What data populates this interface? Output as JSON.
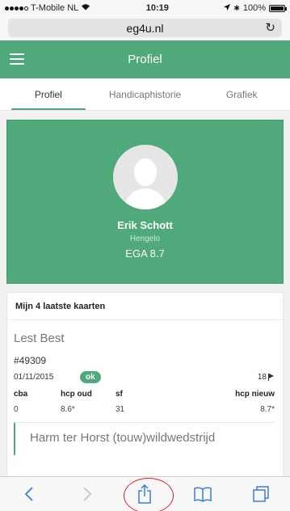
{
  "status_bar": {
    "carrier": "T-Mobile NL",
    "time": "10:19",
    "battery": "100%"
  },
  "browser": {
    "url": "eg4u.nl"
  },
  "header": {
    "title": "Profiel"
  },
  "tabs": [
    {
      "label": "Profiel",
      "active": true
    },
    {
      "label": "Handicaphistorie",
      "active": false
    },
    {
      "label": "Grafiek",
      "active": false
    }
  ],
  "profile": {
    "name": "Erik Schott",
    "city": "Hengelo",
    "ega": "EGA 8.7"
  },
  "cards": {
    "title": "Mijn 4 laatste kaarten",
    "items": [
      {
        "name": "Lest Best",
        "number": "#49309",
        "date": "01/11/2015",
        "status": "ok",
        "holes": "18",
        "headers": [
          "cba",
          "hcp oud",
          "sf",
          "hcp nieuw"
        ],
        "values": [
          "0",
          "8.6*",
          "31",
          "8.7*"
        ]
      }
    ],
    "next_item_name": "Harm ter Horst (touw)wildwedstrijd"
  },
  "colors": {
    "brand": "#4fa97b",
    "highlight_circle": "#d22a2a"
  },
  "toolbar": {
    "icons": [
      "back-icon",
      "forward-icon",
      "share-icon",
      "bookmarks-icon",
      "tabs-icon"
    ]
  }
}
